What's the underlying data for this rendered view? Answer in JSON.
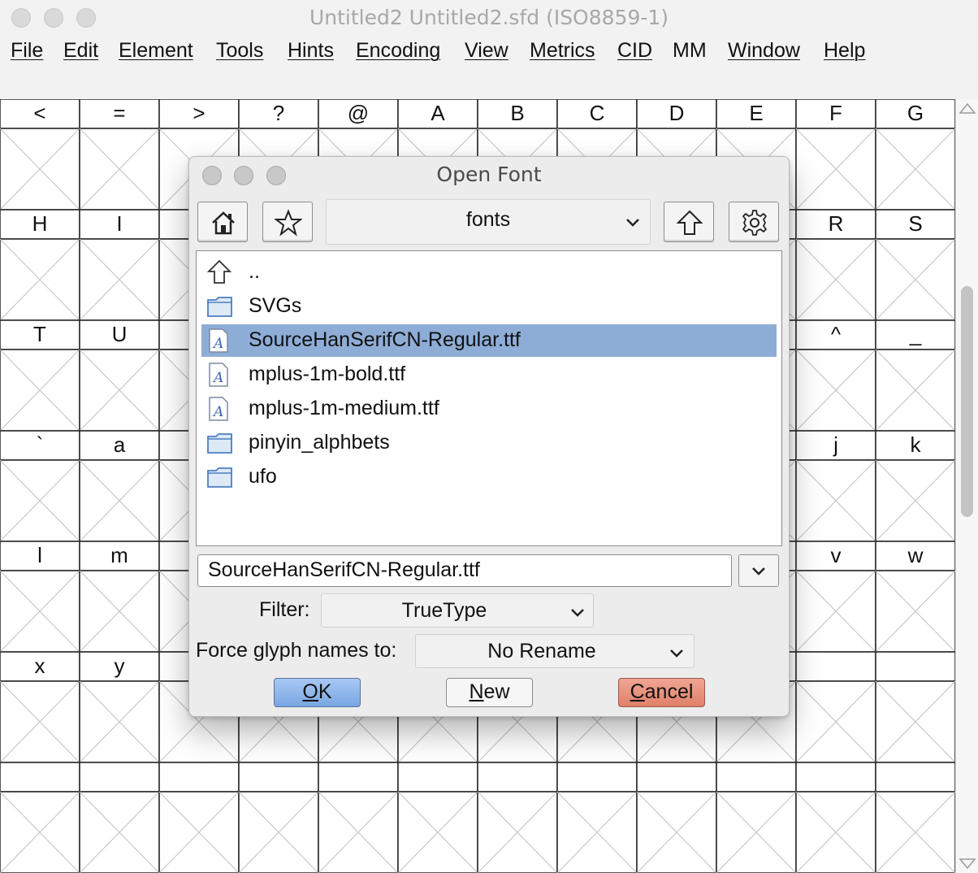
{
  "window": {
    "title": "Untitled2  Untitled2.sfd (ISO8859-1)"
  },
  "menu": [
    {
      "label": "File"
    },
    {
      "label": "Edit"
    },
    {
      "label": "Element"
    },
    {
      "label": "Tools"
    },
    {
      "label": "Hints"
    },
    {
      "label": "Encoding"
    },
    {
      "label": "View"
    },
    {
      "label": "Metrics"
    },
    {
      "label": "CID"
    },
    {
      "label": "MM"
    },
    {
      "label": "Window"
    },
    {
      "label": "Help"
    }
  ],
  "grid": {
    "rows": [
      [
        "<",
        "=",
        ">",
        "?",
        "@",
        "A",
        "B",
        "C",
        "D",
        "E",
        "F",
        "G"
      ],
      [
        "H",
        "I",
        "",
        "",
        "",
        "",
        "",
        "",
        "",
        "",
        "R",
        "S"
      ],
      [
        "T",
        "U",
        "",
        "",
        "",
        "",
        "",
        "",
        "",
        "",
        "^",
        "_"
      ],
      [
        "`",
        "a",
        "",
        "",
        "",
        "",
        "",
        "",
        "",
        "",
        "j",
        "k"
      ],
      [
        "l",
        "m",
        "",
        "",
        "",
        "",
        "",
        "",
        "",
        "",
        "v",
        "w"
      ],
      [
        "x",
        "y",
        "",
        "",
        "",
        "",
        "",
        "",
        "",
        "",
        "",
        ""
      ],
      [
        "",
        "",
        "",
        "",
        "",
        "",
        "",
        "",
        "",
        "",
        "",
        ""
      ]
    ]
  },
  "dialog": {
    "title": "Open Font",
    "toolbar": {
      "home_icon": "home-icon",
      "bookmark_icon": "star-icon",
      "directory": "fonts",
      "up_icon": "up-arrow-icon",
      "settings_icon": "gear-icon"
    },
    "files": [
      {
        "name": "..",
        "icon": "parent-dir-icon",
        "selected": false
      },
      {
        "name": "SVGs",
        "icon": "folder-icon",
        "selected": false
      },
      {
        "name": "SourceHanSerifCN-Regular.ttf",
        "icon": "font-file-icon",
        "selected": true
      },
      {
        "name": "mplus-1m-bold.ttf",
        "icon": "font-file-icon",
        "selected": false
      },
      {
        "name": "mplus-1m-medium.ttf",
        "icon": "font-file-icon",
        "selected": false
      },
      {
        "name": "pinyin_alphbets",
        "icon": "folder-icon",
        "selected": false
      },
      {
        "name": "ufo",
        "icon": "folder-icon",
        "selected": false
      }
    ],
    "filename": "SourceHanSerifCN-Regular.ttf",
    "filter_label": "Filter:",
    "filter_value": "TrueType",
    "force_label": "Force glyph names to:",
    "force_value": "No Rename",
    "buttons": {
      "ok_key": "O",
      "ok_rest": "K",
      "new_key": "N",
      "new_rest": "ew",
      "cancel_key": "C",
      "cancel_rest": "ancel"
    },
    "colors": {
      "selection": "#8eadd6",
      "ok": "#78a6e3",
      "cancel": "#e0806a"
    }
  }
}
